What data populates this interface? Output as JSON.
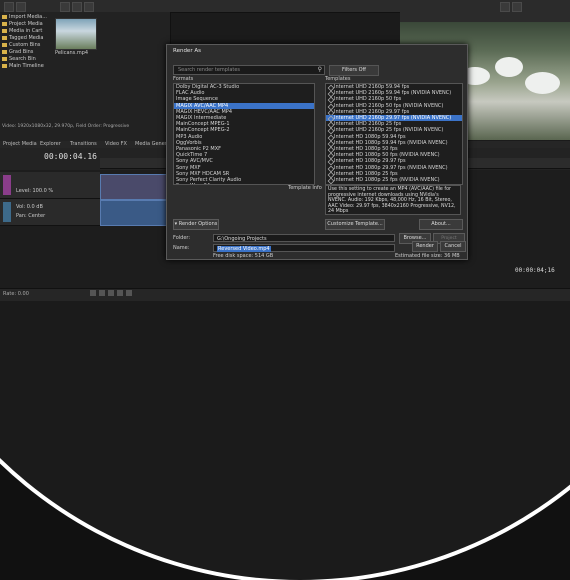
{
  "background": {
    "explorer_tree": [
      "Import Media...",
      "Project Media",
      "Media in Cart",
      "Tagged Media",
      "Custom Bins",
      "Grad Bins",
      "Search Bin",
      "Main Timeline"
    ],
    "thumb_label": "Pelicans.mp4",
    "info_text": "Video: 1920x1080x32, 29.970p, Field Order: Progressive",
    "panel_tabs": [
      "Project Media",
      "Explorer",
      "Transitions",
      "Video FX",
      "Media Generators"
    ],
    "timecode": "00:00:04.16",
    "right_timecode": "00:00:04;16",
    "status_rate": "Rate: 0.00",
    "track_labels": [
      "Level: 100.0 %",
      "Vol: 0.0 dB",
      "Pan: Center"
    ]
  },
  "dialog": {
    "title": "Render As",
    "search_placeholder": "Search render templates",
    "filters_button": "Filters Off",
    "formats_label": "Formats",
    "templates_label": "Templates",
    "formats": [
      "Dolby Digital AC-3 Studio",
      "FLAC Audio",
      "Image Sequence",
      "MAGIX AVC/AAC MP4",
      "MAGIX HEVC/AAC MP4",
      "MAGIX Intermediate",
      "MainConcept MPEG-1",
      "MainConcept MPEG-2",
      "MP3 Audio",
      "OggVorbis",
      "Panasonic P2 MXF",
      "QuickTime 7",
      "Sony AVC/MVC",
      "Sony MXF",
      "Sony MXF HDCAM SR",
      "Sony Perfect Clarity Audio",
      "Sony Wave64",
      "Sony XAVC / XAVC S"
    ],
    "formats_selected": 3,
    "templates": [
      "Internet UHD 2160p 59.94 fps",
      "Internet UHD 2160p 59.94 fps (NVIDIA NVENC)",
      "Internet UHD 2160p 50 fps",
      "Internet UHD 2160p 50 fps (NVIDIA NVENC)",
      "Internet UHD 2160p 29.97 fps",
      "Internet UHD 2160p 29.97 fps (NVIDIA NVENC)",
      "Internet UHD 2160p 25 fps",
      "Internet UHD 2160p 25 fps (NVIDIA NVENC)",
      "Internet HD 1080p 59.94 fps",
      "Internet HD 1080p 59.94 fps (NVIDIA NVENC)",
      "Internet HD 1080p 50 fps",
      "Internet HD 1080p 50 fps (NVIDIA NVENC)",
      "Internet HD 1080p 29.97 fps",
      "Internet HD 1080p 29.97 fps (NVIDIA NVENC)",
      "Internet HD 1080p 25 fps",
      "Internet HD 1080p 25 fps (NVIDIA NVENC)"
    ],
    "templates_selected": 5,
    "template_info_label": "Template Info",
    "template_info": "Use this setting to create an MP4 (AVC/AAC) file for progressive internet downloads using NVidia's NVENC. Audio: 192 Kbps, 48,000 Hz, 16 Bit, Stereo, AAC Video: 29.97 fps, 3840x2160 Progressive, NV12, 24 Mbps",
    "render_options_button": "Render Options",
    "customize_button": "Customize Template...",
    "about_button": "About...",
    "folder_label": "Folder:",
    "folder_value": "G:\\Ongoing Projects",
    "browse_button": "Browse...",
    "project_location_button": "Project Location",
    "name_label": "Name:",
    "name_value": "Reversed Video.mp4",
    "free_space": "Free disk space: 514 GB",
    "estimated_size": "Estimated file size: 36 MB",
    "render_button": "Render",
    "cancel_button": "Cancel"
  }
}
